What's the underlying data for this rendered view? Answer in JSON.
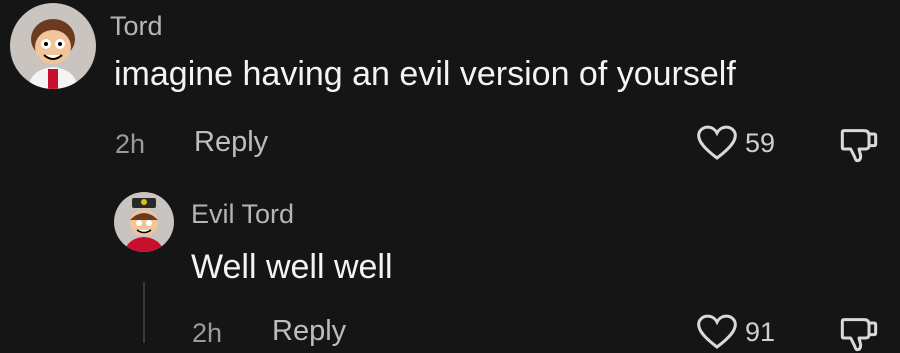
{
  "comments": [
    {
      "author": "Tord",
      "text": "imagine having an evil version of yourself",
      "time": "2h",
      "reply_label": "Reply",
      "likes": "59",
      "avatar": "cartoon-avatar-tord"
    },
    {
      "author": "Evil Tord",
      "text": "Well well well",
      "time": "2h",
      "reply_label": "Reply",
      "likes": "91",
      "avatar": "cartoon-avatar-evil-tord"
    }
  ],
  "icons": {
    "like": "heart-outline-icon",
    "dislike": "thumbs-down-icon"
  },
  "colors": {
    "background": "#151515",
    "text": "#f2f2f2",
    "muted": "#9a9a9a"
  }
}
